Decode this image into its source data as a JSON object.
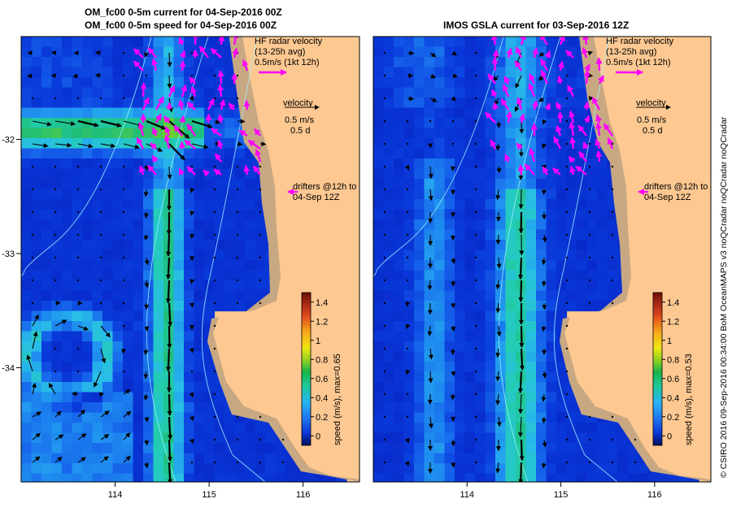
{
  "left_panel": {
    "title_line1": "OM_fc00 0-5m current for 04-Sep-2016 00Z",
    "title_line2": "OM_fc00 0-5m speed for 04-Sep-2016 00Z",
    "colorbar_label": "speed (m/s), max=0.65"
  },
  "right_panel": {
    "title": "IMOS GSLA current for 03-Sep-2016 12Z",
    "colorbar_label": "speed (m/s), max=0.53"
  },
  "legend": {
    "hf_line1": "HF radar velocity",
    "hf_line2": "(13-25h avg)",
    "hf_line3": "0.5m/s (1kt 12h)",
    "vel_line1": "velocity",
    "vel_line2": "0.5 m/s",
    "vel_line3": "0.5 d",
    "drift_line1": "drifters @12h to",
    "drift_line2": "04-Sep 12Z"
  },
  "credit": "© CSIRO 2016   09-Sep-2016 00:34:00 BoM OceanMAPS v3 noQCradar noQCradar noQCradar",
  "chart_data": [
    {
      "type": "heatmap",
      "title": "OM_fc00 0-5m current for 04-Sep-2016 00Z",
      "subtitle": "OM_fc00 0-5m speed for 04-Sep-2016 00Z",
      "x_ticks": [
        114,
        115,
        116
      ],
      "y_ticks": [
        -32,
        -33,
        -34
      ],
      "xlim": [
        113.0,
        116.6
      ],
      "ylim": [
        -35.0,
        -31.1
      ],
      "colorbar": {
        "label": "speed (m/s), max=0.65",
        "ticks": [
          0,
          0.2,
          0.4,
          0.6,
          0.8,
          1.0,
          1.2,
          1.4
        ],
        "range": [
          -0.1,
          1.5
        ]
      },
      "max_speed": 0.65,
      "features": [
        "eastward current band near -31.9",
        "southward current along 114.5"
      ]
    },
    {
      "type": "heatmap",
      "title": "IMOS GSLA current for 03-Sep-2016 12Z",
      "x_ticks": [
        114,
        115,
        116
      ],
      "xlim": [
        113.0,
        116.6
      ],
      "ylim": [
        -35.0,
        -31.1
      ],
      "colorbar": {
        "label": "speed (m/s), max=0.53",
        "ticks": [
          0,
          0.2,
          0.4,
          0.6,
          0.8,
          1.0,
          1.2,
          1.4
        ],
        "range": [
          -0.1,
          1.5
        ]
      },
      "max_speed": 0.53,
      "features": [
        "southward current along 114.5"
      ]
    }
  ],
  "colors": {
    "land": "#fdc891",
    "coast_shelf": "#c8a882",
    "ocean_low": "#0a3fd8",
    "ocean_mid": "#27a7f2",
    "ocean_high": "#2bd3a4",
    "hf_arrow": "#ff00ff",
    "vector": "#000000",
    "bathy": "#9ff3ff"
  }
}
